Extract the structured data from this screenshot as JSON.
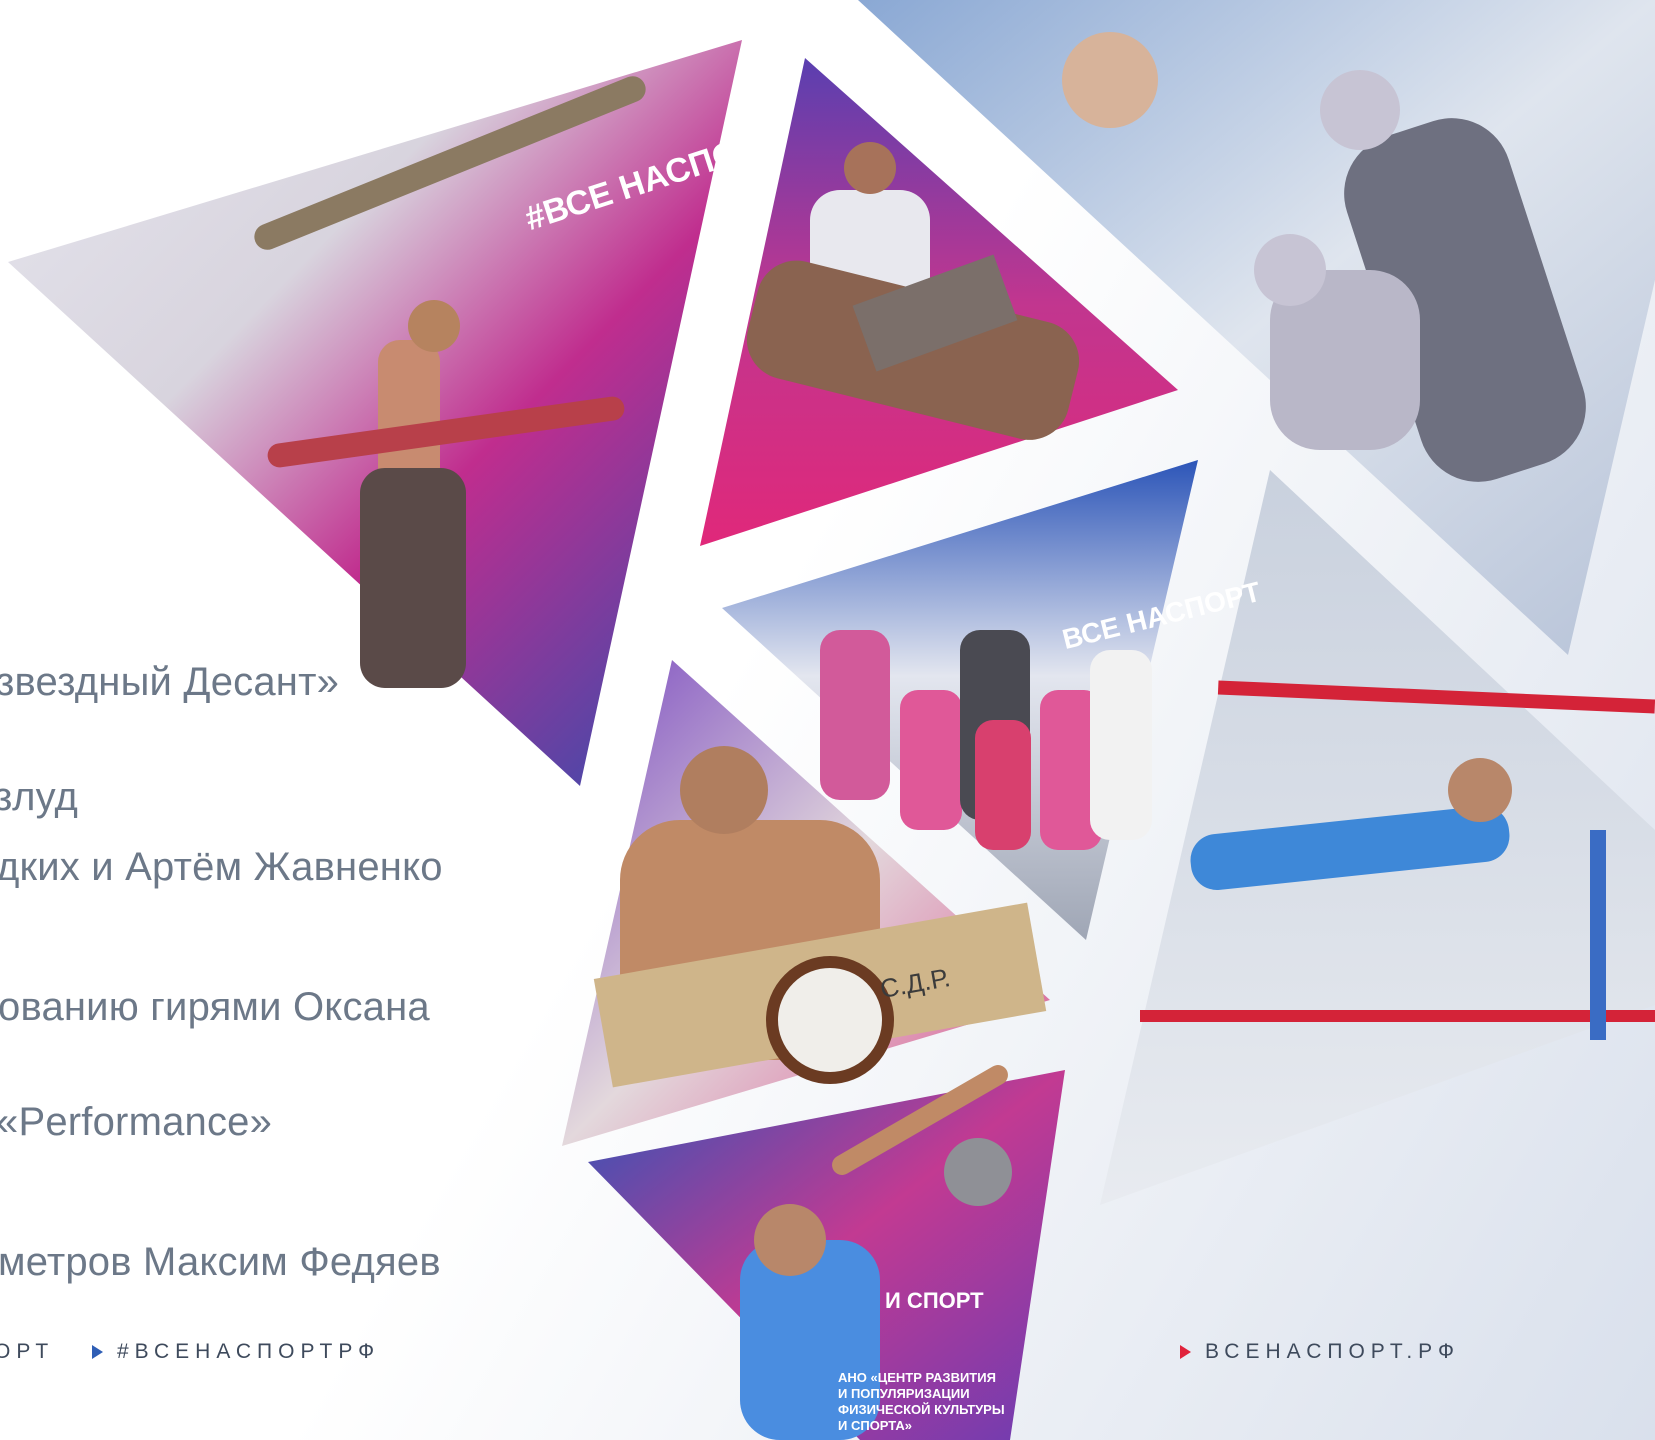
{
  "text_lines": [
    "звездный Десант»",
    "злуд",
    "дких и Артём Жавненко",
    "ованию гирями Оксана",
    "«Performance»",
    "метров Максим Федяев"
  ],
  "footer": {
    "left_partial": "ОРТ",
    "hashtag": "#ВСЕНАСПОРТРФ",
    "site": "ВСЕНАСПОРТ.РФ"
  },
  "photo_texts": {
    "banner_1": "#ВСЕ НАСПОРТ",
    "banner_2": "ВСЕ НАСПОРТ",
    "board": "С.Д.Р.",
    "ano_1": "АНО «ЦЕНТР РАЗВИТИЯ",
    "ano_2": "И ПОПУЛЯРИЗАЦИИ",
    "ano_3": "ФИЗИЧЕСКОЙ КУЛЬТУРЫ",
    "ano_4": "И СПОРТА»",
    "sport": "И СПОРТ"
  },
  "colors": {
    "text_gray": "#6c7888",
    "footer_text": "#3e4a5c",
    "accent_blue": "#2f5eb5",
    "accent_red": "#e0223b",
    "brand_pink": "#e0287a",
    "brand_purple": "#7b3ab8"
  }
}
